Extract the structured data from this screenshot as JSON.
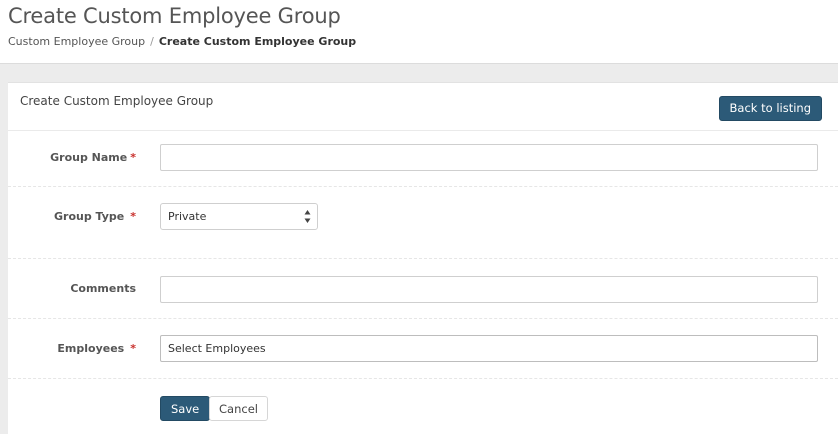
{
  "header": {
    "title": "Create Custom Employee Group",
    "breadcrumb": {
      "parent": "Custom Employee Group",
      "separator": "/",
      "current": "Create Custom Employee Group"
    }
  },
  "panel": {
    "title": "Create Custom Employee Group",
    "back_label": "Back to listing"
  },
  "form": {
    "group_name": {
      "label": "Group Name",
      "required": "*",
      "value": ""
    },
    "group_type": {
      "label": "Group Type",
      "required": "*",
      "selected": "Private"
    },
    "comments": {
      "label": "Comments",
      "value": ""
    },
    "employees": {
      "label": "Employees",
      "required": "*",
      "placeholder": "Select Employees"
    },
    "save_label": "Save",
    "cancel_label": "Cancel"
  },
  "colors": {
    "primary": "#2c5a78",
    "required": "#c9302c",
    "background": "#ececec"
  },
  "icons": {
    "select_arrows": "up-down-arrows-icon"
  }
}
